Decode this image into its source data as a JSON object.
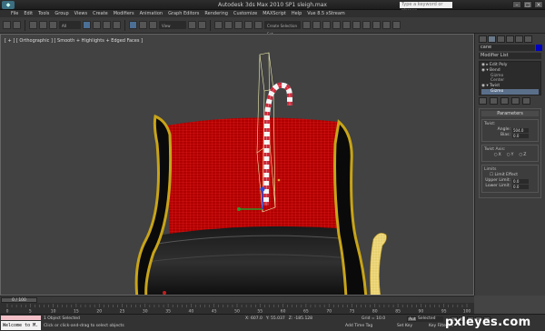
{
  "title": "Autodesk 3ds Max 2010 SP1    sleigh.max",
  "search_placeholder": "Type a keyword or phrase",
  "menu": [
    "File",
    "Edit",
    "Tools",
    "Group",
    "Views",
    "Create",
    "Modifiers",
    "Animation",
    "Graph Editors",
    "Rendering",
    "Customize",
    "MAXScript",
    "Help",
    "Vue 8.5 xStream"
  ],
  "toolbar": {
    "selection_filter": "All",
    "view_dropdown": "View",
    "named_sel": "Create Selection Set"
  },
  "viewport": {
    "label": "[ + ] [ Orthographic ] [ Smooth + Highlights + Edged Faces ]"
  },
  "command_panel": {
    "object_name": "cane",
    "modifier_list": "Modifier List",
    "stack": [
      {
        "label": "Edit Poly",
        "level": 0
      },
      {
        "label": "Bend",
        "level": 0
      },
      {
        "label": "Gizmo",
        "level": 1
      },
      {
        "label": "Center",
        "level": 1
      },
      {
        "label": "Twist",
        "level": 0
      },
      {
        "label": "Gizmo",
        "level": 1,
        "highlight": true
      }
    ],
    "rollout_title": "Parameters",
    "twist_group": "Twist:",
    "angle_label": "Angle:",
    "angle_value": "504.0",
    "bias_label": "Bias:",
    "bias_value": "0.0",
    "axis_group": "Twist Axis:",
    "axes": [
      "X",
      "Y",
      "Z"
    ],
    "limits_group": "Limits",
    "limit_effect": "Limit Effect",
    "upper_label": "Upper Limit:",
    "upper_value": "0.0",
    "lower_label": "Lower Limit:",
    "lower_value": "0.0"
  },
  "time_slider": "0 / 100",
  "timeline_ticks": [
    "0",
    "5",
    "10",
    "15",
    "20",
    "25",
    "30",
    "35",
    "40",
    "45",
    "50",
    "55",
    "60",
    "65",
    "70",
    "75",
    "80",
    "85",
    "90",
    "95",
    "100"
  ],
  "status": {
    "welcome": "Welcome to M.",
    "selected": "1 Object Selected",
    "hint": "Click or click-and-drag to select objects",
    "x": "X: 607.0",
    "y": "Y: 55.037",
    "z": "Z: -185.128",
    "grid": "Grid = 10.0",
    "add_time_tag": "Add Time Tag",
    "auto_key": "Auto Key",
    "selected_dd": "Selected",
    "set_key": "Set Key",
    "key_filters": "Key Filters..."
  },
  "watermark": "pxleyes.com"
}
